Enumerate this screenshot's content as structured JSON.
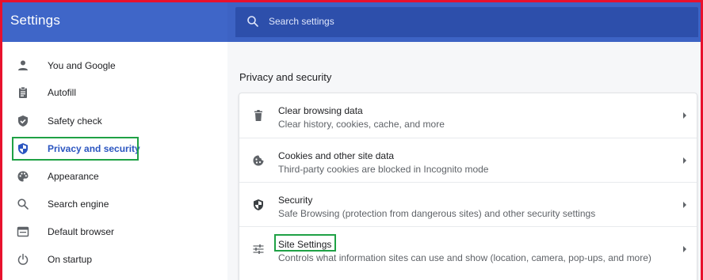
{
  "header": {
    "title": "Settings",
    "search_placeholder": "Search settings"
  },
  "sidebar": {
    "items": [
      {
        "label": "You and Google",
        "icon": "person-icon"
      },
      {
        "label": "Autofill",
        "icon": "clipboard-icon"
      },
      {
        "label": "Safety check",
        "icon": "shield-check-icon"
      },
      {
        "label": "Privacy and security",
        "icon": "privacy-shield-icon",
        "active": true
      },
      {
        "label": "Appearance",
        "icon": "palette-icon"
      },
      {
        "label": "Search engine",
        "icon": "search-icon"
      },
      {
        "label": "Default browser",
        "icon": "browser-icon"
      },
      {
        "label": "On startup",
        "icon": "power-icon"
      }
    ]
  },
  "main": {
    "section_title": "Privacy and security",
    "rows": [
      {
        "title": "Clear browsing data",
        "subtitle": "Clear history, cookies, cache, and more",
        "icon": "trash-icon"
      },
      {
        "title": "Cookies and other site data",
        "subtitle": "Third-party cookies are blocked in Incognito mode",
        "icon": "cookie-icon"
      },
      {
        "title": "Security",
        "subtitle": "Safe Browsing (protection from dangerous sites) and other security settings",
        "icon": "security-shield-icon"
      },
      {
        "title": "Site Settings",
        "subtitle": "Controls what information sites can use and show (location, camera, pop-ups, and more)",
        "icon": "tune-icon"
      }
    ]
  },
  "colors": {
    "header_blue": "#3d63c4",
    "search_blue": "#2d4fab",
    "active_text": "#2b55c0",
    "highlight_green": "#1fa145",
    "frame_red": "#e8112d"
  }
}
